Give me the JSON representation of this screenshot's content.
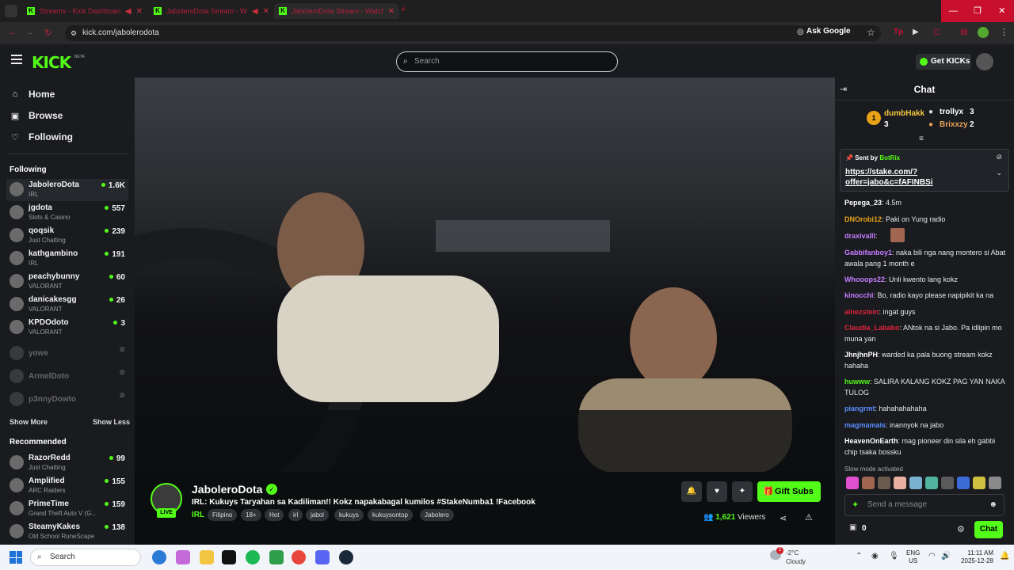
{
  "browser": {
    "tabs": [
      {
        "title": "Streams - Kick Dashboard"
      },
      {
        "title": "JaboleroDota Stream - Wa"
      },
      {
        "title": "JaboleroDota Stream - Watch"
      }
    ],
    "new_tab": "+",
    "url": "kick.com/jabolerodota",
    "ask_google": "Ask Google",
    "window_controls": [
      "—",
      "❐",
      "✕"
    ]
  },
  "header": {
    "logo": "KICK",
    "logo_badge": "BETA",
    "search_placeholder": "Search",
    "get_kicks": "Get KICKs"
  },
  "sidebar": {
    "nav": [
      {
        "label": "Home",
        "icon": "home-icon"
      },
      {
        "label": "Browse",
        "icon": "browse-icon"
      },
      {
        "label": "Following",
        "icon": "heart-icon"
      }
    ],
    "following_title": "Following",
    "following": [
      {
        "name": "JaboleroDota",
        "category": "IRL",
        "viewers": "1.6K",
        "online": true
      },
      {
        "name": "jgdota",
        "category": "Slots & Casino",
        "viewers": "557",
        "online": true
      },
      {
        "name": "qoqsik",
        "category": "Just Chatting",
        "viewers": "239",
        "online": true
      },
      {
        "name": "kathgambino",
        "category": "IRL",
        "viewers": "191",
        "online": true
      },
      {
        "name": "peachybunny",
        "category": "VALORANT",
        "viewers": "60",
        "online": true
      },
      {
        "name": "danicakesgg",
        "category": "VALORANT",
        "viewers": "26",
        "online": true
      },
      {
        "name": "KPDOdoto",
        "category": "VALORANT",
        "viewers": "3",
        "online": true
      },
      {
        "name": "yowe",
        "category": "",
        "viewers": "",
        "online": false
      },
      {
        "name": "ArmelDoto",
        "category": "",
        "viewers": "",
        "online": false
      },
      {
        "name": "p3nnyDowto",
        "category": "",
        "viewers": "",
        "online": false
      }
    ],
    "show_more": "Show More",
    "show_less": "Show Less",
    "recommended_title": "Recommended",
    "recommended": [
      {
        "name": "RazorRedd",
        "category": "Just Chatting",
        "viewers": "99"
      },
      {
        "name": "Amplified",
        "category": "ARC Raiders",
        "viewers": "155"
      },
      {
        "name": "PrimeTime",
        "category": "Grand Theft Auto V (G...",
        "viewers": "159"
      },
      {
        "name": "SteamyKakes",
        "category": "Old School RuneScape",
        "viewers": "138"
      }
    ]
  },
  "stream": {
    "channel": "JaboleroDota",
    "live_badge": "LIVE",
    "title": "IRL: Kukuys Taryahan sa Kadiliman!! Kokz napakabagal kumilos #StakeNumba1 !Facebook",
    "category": "IRL",
    "tags": [
      "Filipino",
      "18+",
      "Hot",
      "irl",
      "jabol",
      "kukuys",
      "kukuysontop",
      "Jabolero"
    ],
    "gift_subs": "Gift Subs",
    "viewer_count": "1,621",
    "viewers_label": "Viewers"
  },
  "chat": {
    "title": "Chat",
    "leaderboard": [
      {
        "rank": "1",
        "name": "dumbHakk",
        "count": "3",
        "color": "#f5c542"
      },
      {
        "rank": "2",
        "name": "trollyx",
        "count": "3",
        "color": "#ffffff"
      },
      {
        "rank": "3",
        "name": "Brixxzy",
        "count": "2",
        "color": "#e8a35a"
      }
    ],
    "pinned": {
      "sent_by": "Sent by",
      "bot": "BotRix",
      "link": "https://stake.com/?offer=jabo&c=fAFINBSi"
    },
    "messages": [
      {
        "user": "Pepega_23",
        "text": "4.5m",
        "color": "#ffffff"
      },
      {
        "user": "DNOrobi12",
        "text": "Paki on Yung radio",
        "color": "#e8a317"
      },
      {
        "user": "draxivalll",
        "text": "",
        "color": "#c77dff"
      },
      {
        "user": "Gabbifanboy1",
        "text": "naka bili nga nang montero si Abat awala pang 1 month e",
        "color": "#c77dff"
      },
      {
        "user": "Whooops22",
        "text": "Unli kwento lang kokz",
        "color": "#c77dff"
      },
      {
        "user": "kinocchi",
        "text": "Bo, radio kayo please napipikit ka na",
        "color": "#c77dff"
      },
      {
        "user": "ainezstein",
        "text": "ingat guys",
        "color": "#e0233c"
      },
      {
        "user": "Claudia_Lababo",
        "text": "ANtok na si Jabo. Pa idlipin mo muna yan",
        "color": "#e0233c"
      },
      {
        "user": "JhnjhnPH",
        "text": "warded ka pala buong stream kokz hahaha",
        "color": "#ffffff"
      },
      {
        "user": "huwww",
        "text": "SALIRA KALANG KOKZ PAG YAN NAKA TULOG",
        "color": "#53fc18"
      },
      {
        "user": "piangrmt",
        "text": "hahahahahaha",
        "color": "#5b8cff"
      },
      {
        "user": "magmamais",
        "text": "inannyok na jabo",
        "color": "#5b8cff"
      },
      {
        "user": "HeavenOnEarth",
        "text": "mag pioneer din sila eh gabbi chip tsaka bossku",
        "color": "#ffffff"
      }
    ],
    "slow_mode": "Slow mode activated",
    "send_placeholder": "Send a message",
    "kicks_count": "0",
    "chat_button": "Chat"
  },
  "taskbar": {
    "search": "Search",
    "weather_temp": "-2°C",
    "weather_desc": "Cloudy",
    "weather_badge": "2",
    "lang1": "ENG",
    "lang2": "US",
    "time": "11:11 AM",
    "date": "2025-12-28"
  }
}
